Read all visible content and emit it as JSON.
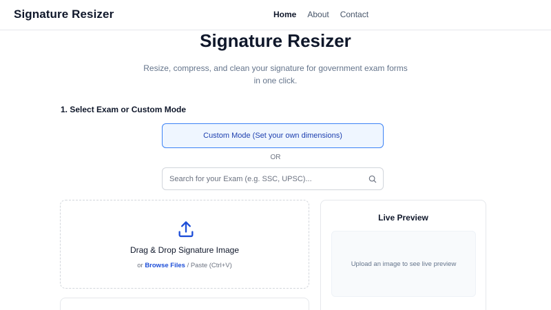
{
  "navbar": {
    "brand": "Signature Resizer",
    "links": [
      {
        "label": "Home",
        "active": true
      },
      {
        "label": "About",
        "active": false
      },
      {
        "label": "Contact",
        "active": false
      }
    ]
  },
  "hero": {
    "title": "Signature Resizer",
    "subtitle": "Resize, compress, and clean your signature for government exam forms in one click."
  },
  "exam_section": {
    "label": "1. Select Exam or Custom Mode",
    "custom_mode_label": "Custom Mode (Set your own dimensions)",
    "or_text": "OR",
    "search_placeholder": "Search for your Exam (e.g. SSC, UPSC)...",
    "search_value": ""
  },
  "upload": {
    "title": "Drag & Drop Signature Image",
    "prefix": "or",
    "browse_label": "Browse Files",
    "suffix": "/ Paste (Ctrl+V)"
  },
  "preview": {
    "title": "Live Preview",
    "placeholder": "Upload an image to see live preview"
  },
  "colors": {
    "accent": "#3b82f6",
    "accent_bg": "#eff6ff",
    "link": "#1d4ed8",
    "text": "#0f172a",
    "muted": "#64748b"
  },
  "icons": {
    "search": "search-icon",
    "upload": "upload-icon"
  }
}
